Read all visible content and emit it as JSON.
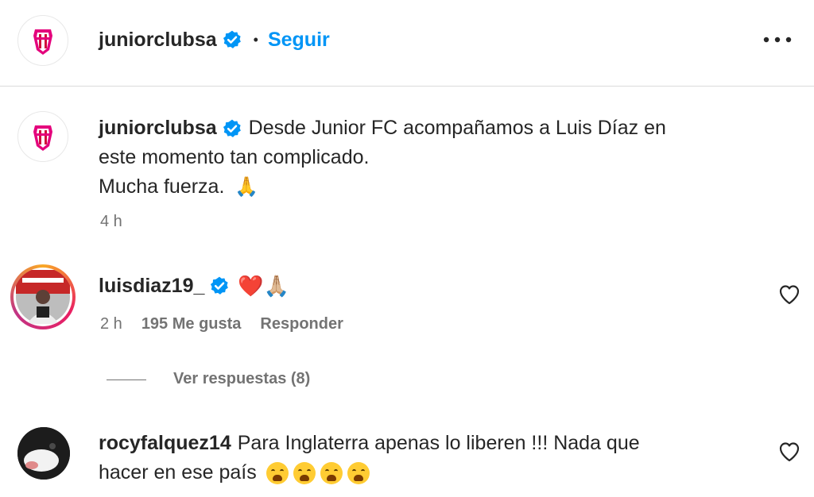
{
  "header": {
    "username": "juniorclubsa",
    "separator": "•",
    "follow_label": "Seguir",
    "more_icon": "more-horizontal-icon"
  },
  "post": {
    "username": "juniorclubsa",
    "caption_line1": "Desde Junior FC acompañamos a Luis Díaz en",
    "caption_line2": "este momento tan complicado.",
    "caption_line3": "Mucha fuerza.",
    "caption_emoji": "🙏",
    "time": "4 h"
  },
  "comments": [
    {
      "username": "luisdiaz19_",
      "text": "❤️🙏🏼",
      "time": "2 h",
      "likes": "195 Me gusta",
      "reply_label": "Responder",
      "view_replies": "Ver respuestas (8)"
    },
    {
      "username": "rocyfalquez14",
      "text_line1": "Para Inglaterra apenas lo liberen !!! Nada que",
      "text_line2": "hacer en ese país"
    }
  ],
  "colors": {
    "accent": "#0095f6",
    "verified": "#0095f6",
    "club_pink": "#e4007c",
    "club_red": "#d0103a"
  }
}
